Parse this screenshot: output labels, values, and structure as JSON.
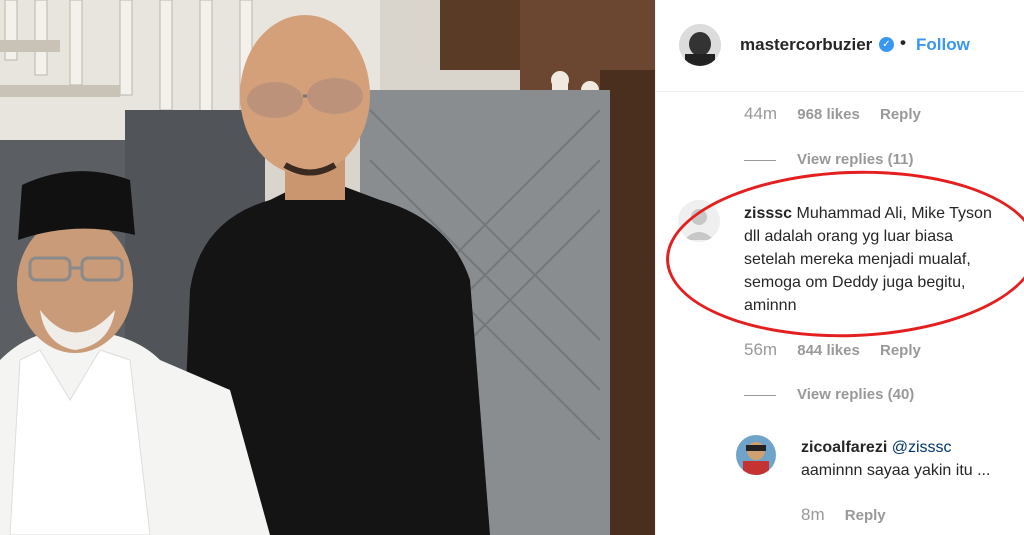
{
  "post": {
    "username": "mastercorbuzier",
    "verified_badge": "✓",
    "separator": "•",
    "follow_label": "Follow"
  },
  "comments": [
    {
      "time": "44m",
      "likes": "968 likes",
      "reply": "Reply"
    }
  ],
  "view_replies_1": "View replies (11)",
  "featured_comment": {
    "username": "zisssc",
    "text_line1": "Muhammad Ali, Mike Tyson",
    "text_line2": "dll adalah orang yg luar biasa",
    "text_line3": "setelah mereka menjadi mualaf,",
    "text_line4": "semoga om Deddy juga begitu,",
    "text_line5": "aminnn",
    "time": "56m",
    "likes": "844 likes",
    "reply": "Reply"
  },
  "view_replies_2": "View replies (40)",
  "reply_comment": {
    "username": "zicoalfarezi",
    "mention": "@zisssc",
    "text": "aaminnn sayaa yakin itu ...",
    "time": "8m",
    "reply": "Reply"
  },
  "colors": {
    "link_blue": "#3897f0",
    "highlight_red": "#e41f1f",
    "muted_gray": "#999999"
  }
}
